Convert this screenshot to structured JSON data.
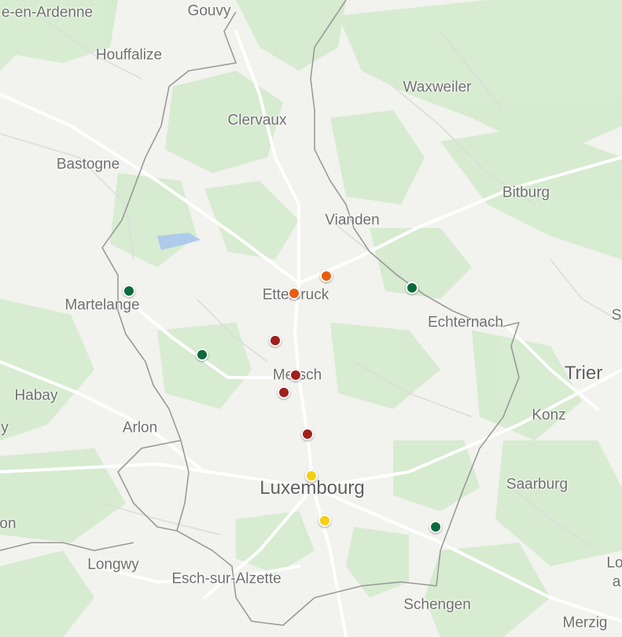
{
  "map": {
    "labels": {
      "gouvy": "Gouvy",
      "houffalize": "Houffalize",
      "en_ardenne": "e-en-Ardenne",
      "clervaux": "Clervaux",
      "waxweiler": "Waxweiler",
      "bastogne": "Bastogne",
      "bitburg": "Bitburg",
      "vianden": "Vianden",
      "martelange": "Martelange",
      "ettelbruck": "Ettelbruck",
      "echternach": "Echternach",
      "s_edge": "S",
      "trier": "Trier",
      "habay": "Habay",
      "mersch": "Mersch",
      "konz": "Konz",
      "arlon": "Arlon",
      "y_edge": "y",
      "saarburg": "Saarburg",
      "luxembourg": "Luxembourg",
      "on_edge": "on",
      "longwy": "Longwy",
      "esch": "Esch-sur-Alzette",
      "lo_edge": "Lo",
      "a_edge": "a",
      "schengen": "Schengen",
      "merzig": "Merzig"
    },
    "marker_colors": {
      "green": "#0b6b3a",
      "orange": "#e85d0c",
      "darkred": "#a21f1c",
      "yellow": "#f5cf10"
    },
    "markers": [
      {
        "name": "station-marker-martelange",
        "color": "green"
      },
      {
        "name": "station-marker-west",
        "color": "green"
      },
      {
        "name": "station-marker-vianden-border",
        "color": "green"
      },
      {
        "name": "station-marker-schengen-north",
        "color": "green"
      },
      {
        "name": "station-marker-ettelbruck",
        "color": "orange"
      },
      {
        "name": "station-marker-northeast-ettelbruck",
        "color": "orange"
      },
      {
        "name": "station-marker-north-mersch",
        "color": "darkred"
      },
      {
        "name": "station-marker-mersch",
        "color": "darkred"
      },
      {
        "name": "station-marker-south-mersch",
        "color": "darkred"
      },
      {
        "name": "station-marker-north-luxembourg",
        "color": "darkred"
      },
      {
        "name": "station-marker-luxembourg",
        "color": "yellow"
      },
      {
        "name": "station-marker-luxembourg-south",
        "color": "yellow"
      }
    ]
  }
}
